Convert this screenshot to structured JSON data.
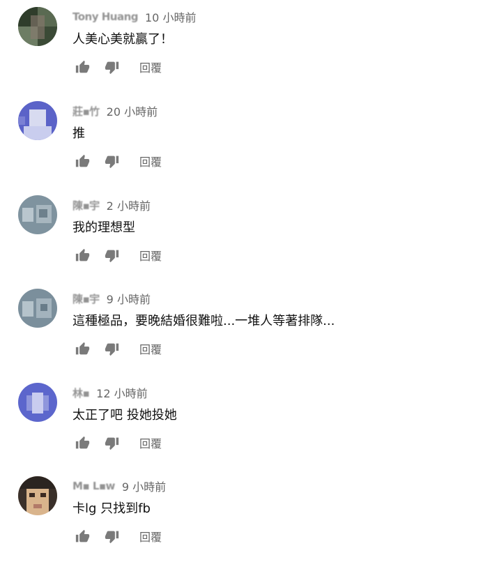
{
  "comments": [
    {
      "author": "Tony Huang",
      "time": "10 小時前",
      "text": "人美心美就贏了！",
      "reply_label": "回覆",
      "avatar_color": "#3f5a3a"
    },
    {
      "author": "莊▪竹",
      "time": "20 小時前",
      "text": "推",
      "reply_label": "回覆",
      "avatar_color": "#5b63c8"
    },
    {
      "author": "陳▪宇",
      "time": "2 小時前",
      "text": "我的理想型",
      "reply_label": "回覆",
      "avatar_color": "#7f939f"
    },
    {
      "author": "陳▪宇",
      "time": "9 小時前",
      "text": "這種極品，要晚結婚很難啦...一堆人等著排隊...",
      "reply_label": "回覆",
      "avatar_color": "#7b8f9c"
    },
    {
      "author": "林▪",
      "time": "12 小時前",
      "text": "太正了吧 投她投她",
      "reply_label": "回覆",
      "avatar_color": "#5c66cc"
    },
    {
      "author": "M▪ L▪w",
      "time": "9 小時前",
      "text": "卡lg 只找到fb",
      "reply_label": "回覆",
      "avatar_color": "#d9b48c"
    }
  ],
  "icons": {
    "like": "thumb-up-icon",
    "dislike": "thumb-down-icon",
    "avatar": "avatar"
  }
}
